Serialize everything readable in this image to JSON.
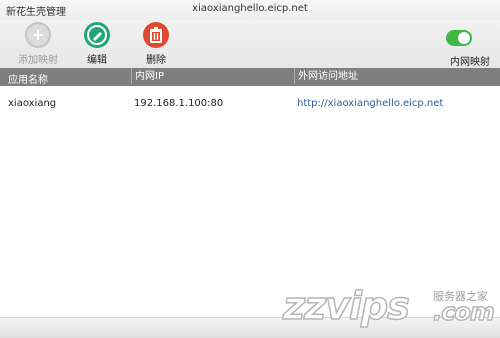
{
  "window": {
    "app_name": "新花生壳管理",
    "title": "xiaoxianghello.eicp.net"
  },
  "toolbar": {
    "add_label": "添加映射",
    "edit_label": "编辑",
    "delete_label": "删除",
    "toggle_label": "内网映射",
    "toggle_on": true
  },
  "table": {
    "columns": [
      "应用名称",
      "内网IP",
      "外网访问地址"
    ],
    "rows": [
      {
        "name": "xiaoxiang",
        "ip": "192.168.1.100:80",
        "url": "http://xiaoxianghello.eicp.net"
      }
    ]
  },
  "watermark": {
    "main": "zzvips",
    "side": "服务器之家",
    "suffix": ".com"
  },
  "colors": {
    "accent_green": "#3db943",
    "edit_green": "#1fa578",
    "delete_red": "#de4a2f",
    "header_grey": "#7f7f7f",
    "link_blue": "#2f5d9e"
  }
}
